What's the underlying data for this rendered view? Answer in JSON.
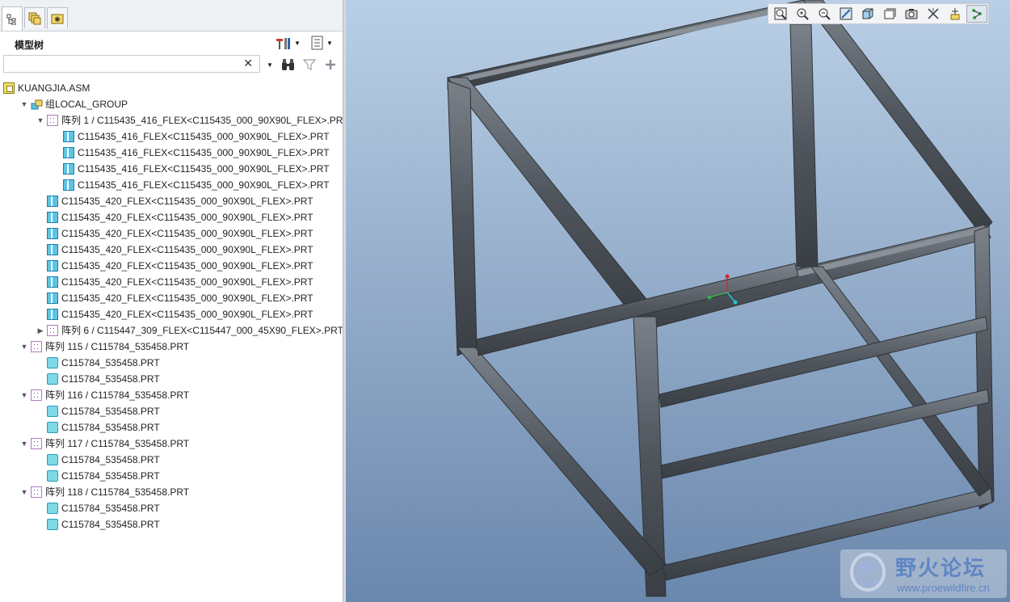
{
  "model_tree": {
    "title": "模型树",
    "search": {
      "value": "",
      "clear": "✕"
    },
    "tabs": [
      {
        "name": "model-tree-tab-icon"
      },
      {
        "name": "layers-tab-icon"
      },
      {
        "name": "favorites-tab-icon"
      }
    ],
    "rows": [
      {
        "label": "KUANGJIA.ASM",
        "icon": "assembly-icon",
        "toggle": ""
      },
      {
        "label": "组LOCAL_GROUP",
        "icon": "group-icon",
        "toggle": "▼"
      },
      {
        "label": "阵列 1 / C115435_416_FLEX<C115435_000_90X90L_FLEX>.PRT",
        "icon": "pattern-icon",
        "toggle": "▼"
      },
      {
        "label": "C115435_416_FLEX<C115435_000_90X90L_FLEX>.PRT",
        "icon": "flexible-part-icon",
        "toggle": ""
      },
      {
        "label": "C115435_416_FLEX<C115435_000_90X90L_FLEX>.PRT",
        "icon": "flexible-part-icon",
        "toggle": ""
      },
      {
        "label": "C115435_416_FLEX<C115435_000_90X90L_FLEX>.PRT",
        "icon": "flexible-part-icon",
        "toggle": ""
      },
      {
        "label": "C115435_416_FLEX<C115435_000_90X90L_FLEX>.PRT",
        "icon": "flexible-part-icon",
        "toggle": ""
      },
      {
        "label": "C115435_420_FLEX<C115435_000_90X90L_FLEX>.PRT",
        "icon": "flexible-part-icon",
        "toggle": ""
      },
      {
        "label": "C115435_420_FLEX<C115435_000_90X90L_FLEX>.PRT",
        "icon": "flexible-part-icon",
        "toggle": ""
      },
      {
        "label": "C115435_420_FLEX<C115435_000_90X90L_FLEX>.PRT",
        "icon": "flexible-part-icon",
        "toggle": ""
      },
      {
        "label": "C115435_420_FLEX<C115435_000_90X90L_FLEX>.PRT",
        "icon": "flexible-part-icon",
        "toggle": ""
      },
      {
        "label": "C115435_420_FLEX<C115435_000_90X90L_FLEX>.PRT",
        "icon": "flexible-part-icon",
        "toggle": ""
      },
      {
        "label": "C115435_420_FLEX<C115435_000_90X90L_FLEX>.PRT",
        "icon": "flexible-part-icon",
        "toggle": ""
      },
      {
        "label": "C115435_420_FLEX<C115435_000_90X90L_FLEX>.PRT",
        "icon": "flexible-part-icon",
        "toggle": ""
      },
      {
        "label": "C115435_420_FLEX<C115435_000_90X90L_FLEX>.PRT",
        "icon": "flexible-part-icon",
        "toggle": ""
      },
      {
        "label": "阵列 6 / C115447_309_FLEX<C115447_000_45X90_FLEX>.PRT",
        "icon": "pattern-icon",
        "toggle": "▶"
      },
      {
        "label": "阵列 115 / C115784_535458.PRT",
        "icon": "pattern-icon",
        "toggle": "▼"
      },
      {
        "label": "C115784_535458.PRT",
        "icon": "part-icon",
        "toggle": ""
      },
      {
        "label": "C115784_535458.PRT",
        "icon": "part-icon",
        "toggle": ""
      },
      {
        "label": "阵列 116 / C115784_535458.PRT",
        "icon": "pattern-icon",
        "toggle": "▼"
      },
      {
        "label": "C115784_535458.PRT",
        "icon": "part-icon",
        "toggle": ""
      },
      {
        "label": "C115784_535458.PRT",
        "icon": "part-icon",
        "toggle": ""
      },
      {
        "label": "阵列 117 / C115784_535458.PRT",
        "icon": "pattern-icon",
        "toggle": "▼"
      },
      {
        "label": "C115784_535458.PRT",
        "icon": "part-icon",
        "toggle": ""
      },
      {
        "label": "C115784_535458.PRT",
        "icon": "part-icon",
        "toggle": ""
      },
      {
        "label": "阵列 118 / C115784_535458.PRT",
        "icon": "pattern-icon",
        "toggle": "▼"
      },
      {
        "label": "C115784_535458.PRT",
        "icon": "part-icon",
        "toggle": ""
      },
      {
        "label": "C115784_535458.PRT",
        "icon": "part-icon",
        "toggle": ""
      }
    ]
  },
  "view_toolbar": [
    "refit-icon",
    "zoom-in-icon",
    "zoom-out-icon",
    "repaint-icon",
    "display-style-icon",
    "saved-views-icon",
    "view-manager-icon",
    "datum-display-icon",
    "spin-center-icon",
    "annotation-display-icon"
  ],
  "watermark": {
    "title": "野火论坛",
    "url": "www.proewildfire.cn"
  },
  "colors": {
    "viewport_top": "#b9cfe6",
    "viewport_bottom": "#6a87ad",
    "profile": "#4a4f55"
  }
}
